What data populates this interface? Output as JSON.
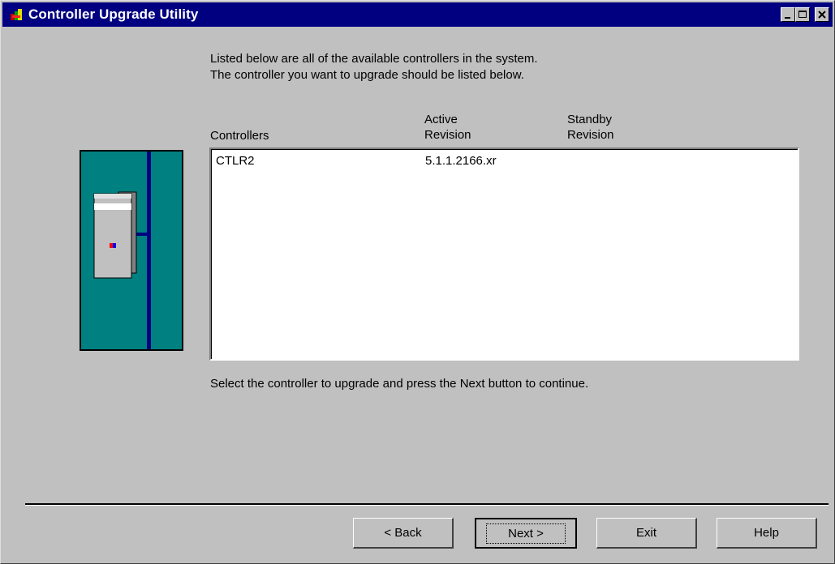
{
  "window": {
    "title": "Controller Upgrade Utility",
    "controls": [
      "minimize-icon",
      "maximize-icon",
      "close-icon"
    ]
  },
  "intro": {
    "line1": "Listed below are all of the available controllers in the system.",
    "line2": "The controller you want to upgrade should be listed below."
  },
  "columns": {
    "controllers": "Controllers",
    "active_line1": "Active",
    "active_line2": "Revision",
    "standby_line1": "Standby",
    "standby_line2": "Revision"
  },
  "controllers": [
    {
      "name": "CTLR2",
      "active_revision": "5.1.1.2166.xr",
      "standby_revision": ""
    }
  ],
  "hint": "Select the controller to upgrade and press the Next button to continue.",
  "buttons": {
    "back": "< Back",
    "next": "Next >",
    "exit": "Exit",
    "help": "Help"
  },
  "colors": {
    "title_bar": "#000080",
    "cabinet": "#008080",
    "bus": "#000080",
    "face": "#c0c0c0"
  }
}
